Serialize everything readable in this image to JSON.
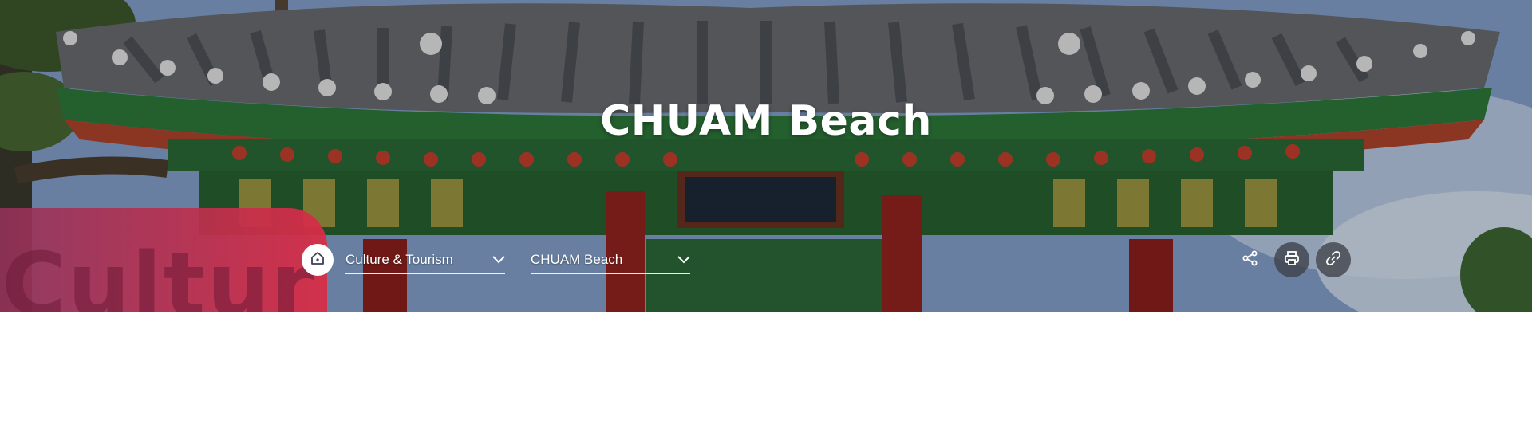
{
  "header": {
    "title": "CHUAM Beach",
    "badge_word": "Cultur"
  },
  "breadcrumb": {
    "home_icon": "home-icon",
    "items": [
      {
        "label": "Culture & Tourism",
        "icon": "chevron-down-icon"
      },
      {
        "label": "CHUAM Beach",
        "icon": "chevron-down-icon"
      }
    ]
  },
  "actions": {
    "share_icon": "share-icon",
    "print_icon": "printer-icon",
    "link_icon": "link-icon"
  },
  "colors": {
    "badge_start": "#96325a",
    "badge_end": "#d72d46",
    "action_button_bg": "#3c4048",
    "text": "#ffffff"
  }
}
